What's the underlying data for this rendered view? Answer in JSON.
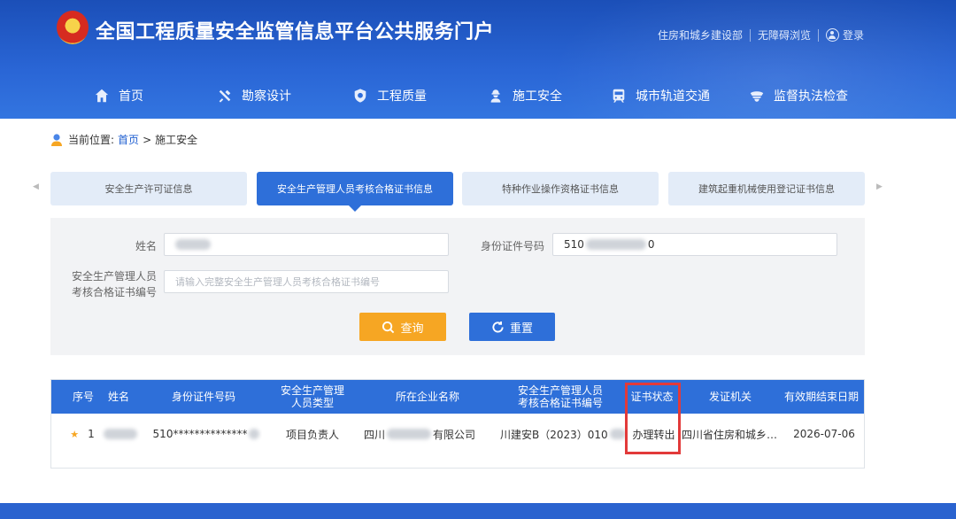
{
  "header": {
    "site_title": "全国工程质量安全监管信息平台公共服务门户",
    "links": [
      "住房和城乡建设部",
      "无障碍浏览"
    ],
    "login_label": "登录"
  },
  "nav": [
    {
      "label": "首页",
      "icon": "home-icon"
    },
    {
      "label": "勘察设计",
      "icon": "tools-icon"
    },
    {
      "label": "工程质量",
      "icon": "shield-icon"
    },
    {
      "label": "施工安全",
      "icon": "worker-icon"
    },
    {
      "label": "城市轨道交通",
      "icon": "train-icon"
    },
    {
      "label": "监督执法检查",
      "icon": "police-cap-icon"
    }
  ],
  "breadcrumb": {
    "prefix": "当前位置:",
    "home": "首页",
    "separator": ">",
    "current": "施工安全"
  },
  "tabs": [
    {
      "label": "安全生产许可证信息",
      "active": false
    },
    {
      "label": "安全生产管理人员考核合格证书信息",
      "active": true
    },
    {
      "label": "特种作业操作资格证书信息",
      "active": false
    },
    {
      "label": "建筑起重机械使用登记证书信息",
      "active": false
    }
  ],
  "search": {
    "name_label": "姓名",
    "name_value": "",
    "id_label": "身份证件号码",
    "id_value_prefix": "510",
    "id_value_suffix": "0",
    "cert_label_line1": "安全生产管理人员",
    "cert_label_line2": "考核合格证书编号",
    "cert_placeholder": "请输入完整安全生产管理人员考核合格证书编号",
    "query_button": "查询",
    "reset_button": "重置"
  },
  "table": {
    "headers": [
      "序号",
      "姓名",
      "身份证件号码",
      "安全生产管理\n人员类型",
      "所在企业名称",
      "安全生产管理人员\n考核合格证书编号",
      "证书状态",
      "发证机关",
      "有效期结束日期"
    ],
    "rows": [
      {
        "index": "1",
        "name": "",
        "id_number": "510**************",
        "person_type": "项目负责人",
        "company_prefix": "四川",
        "company_suffix": "有限公司",
        "cert_number": "川建安B（2023）010",
        "status": "办理转出",
        "issuer": "四川省住房和城乡…",
        "expiry": "2026-07-06"
      }
    ]
  },
  "colors": {
    "primary": "#2e6fd9",
    "query_button": "#f6a623",
    "highlight_box": "#e23a3a"
  }
}
